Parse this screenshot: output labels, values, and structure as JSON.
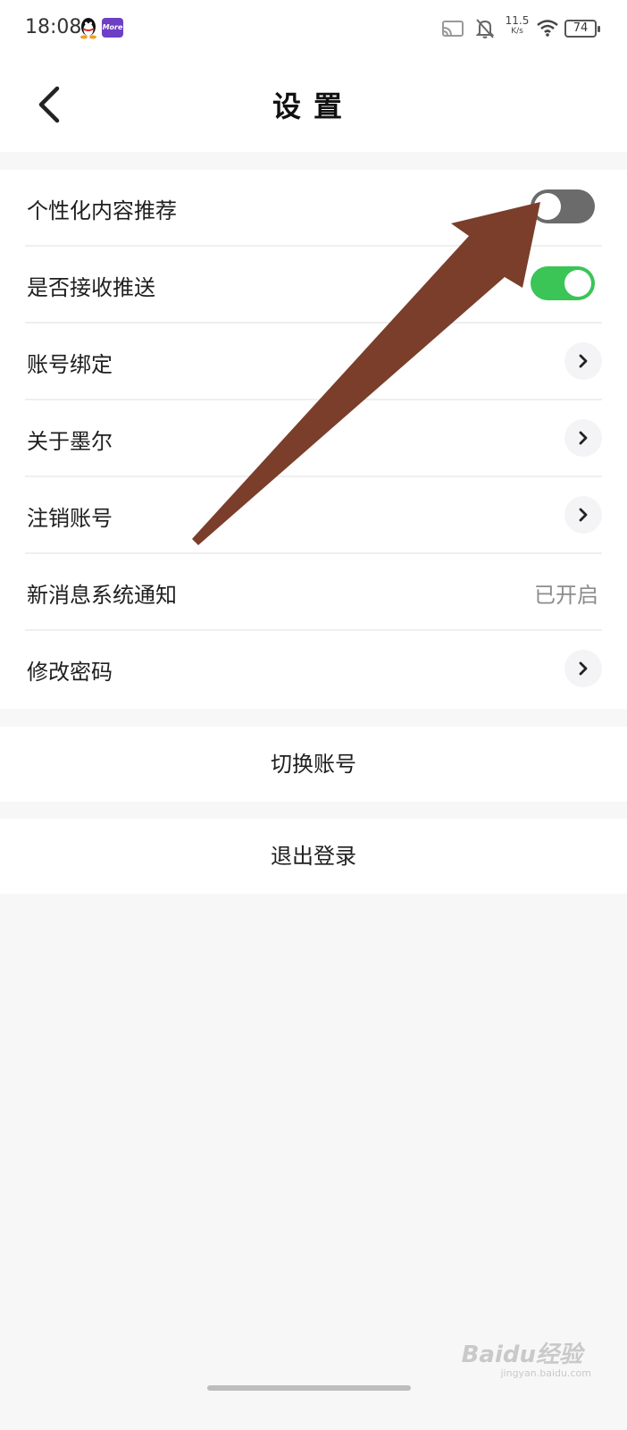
{
  "status_bar": {
    "time": "18:08",
    "app_icon_label": "More",
    "net_speed_value": "11.5",
    "net_speed_unit": "K/s",
    "battery": "74"
  },
  "header": {
    "title": "设置"
  },
  "settings": {
    "personalized": {
      "label": "个性化内容推荐",
      "toggle": "off"
    },
    "push": {
      "label": "是否接收推送",
      "toggle": "on"
    },
    "binding": {
      "label": "账号绑定"
    },
    "about": {
      "label": "关于墨尔"
    },
    "deregister": {
      "label": "注销账号"
    },
    "notification": {
      "label": "新消息系统通知",
      "value": "已开启"
    },
    "password": {
      "label": "修改密码"
    }
  },
  "actions": {
    "switch_account": "切换账号",
    "logout": "退出登录"
  },
  "overlay": {
    "arrow_color": "#7a3e2b",
    "toggle_on_color": "#3ac556",
    "toggle_off_color": "#6b6b6b"
  },
  "watermark": {
    "main": "Baidu经验",
    "sub": "jingyan.baidu.com"
  }
}
